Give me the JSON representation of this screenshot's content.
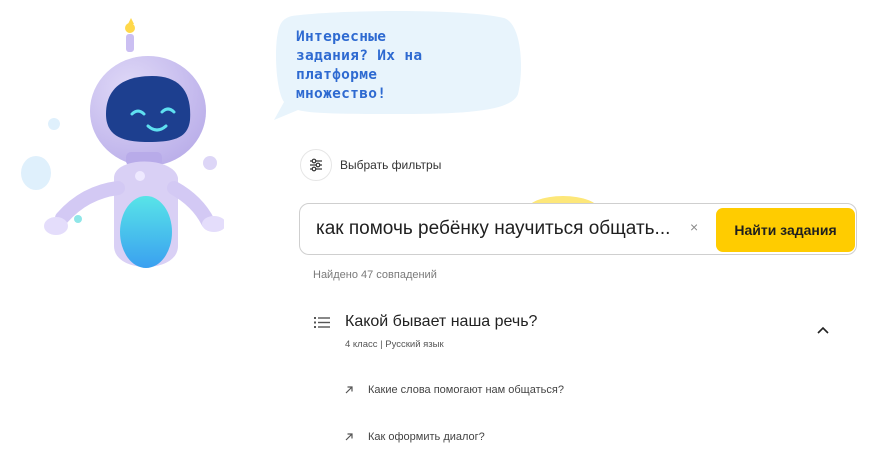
{
  "promo": {
    "bubble_lines": [
      "Интересные",
      "задания? Их на",
      "платформе",
      "множество!"
    ]
  },
  "filters": {
    "button_label": "Выбрать фильтры",
    "icon": "sliders-icon"
  },
  "search": {
    "value": "как помочь ребёнку научиться общать...",
    "clear_glyph": "×",
    "submit_label": "Найти задания"
  },
  "results": {
    "count_text": "Найдено 47 совпадений",
    "items": [
      {
        "title": "Какой бывает наша речь?",
        "meta": "4 класс | Русский язык",
        "expanded": true,
        "subitems": [
          {
            "label": "Какие слова помогают нам общаться?"
          },
          {
            "label": "Как оформить диалог?"
          }
        ]
      }
    ]
  },
  "colors": {
    "accent_yellow": "#ffcc00",
    "bubble_text": "#2e6ad1",
    "bubble_bg": "#e8f4fc",
    "robot_body": "#d9d0f5",
    "robot_face": "#1d3f8f"
  }
}
